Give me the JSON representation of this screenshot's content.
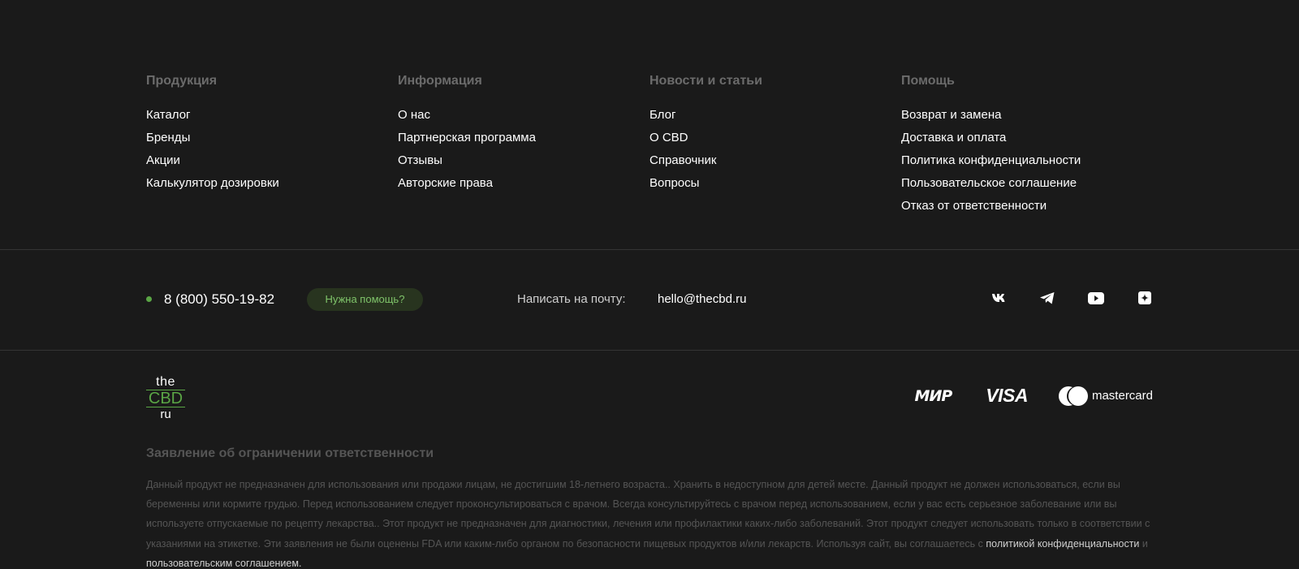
{
  "columns": [
    {
      "title": "Продукция",
      "items": [
        "Каталог",
        "Бренды",
        "Акции",
        "Калькулятор дозировки"
      ]
    },
    {
      "title": "Информация",
      "items": [
        "О нас",
        "Партнерская программа",
        "Отзывы",
        "Авторские права"
      ]
    },
    {
      "title": "Новости и статьи",
      "items": [
        "Блог",
        "О CBD",
        "Справочник",
        "Вопросы"
      ]
    },
    {
      "title": "Помощь",
      "items": [
        "Возврат и замена",
        "Доставка и оплата",
        "Политика конфиденциальности",
        "Пользовательское соглашение",
        "Отказ от ответственности"
      ]
    }
  ],
  "contact": {
    "phone": "8 (800) 550-19-82",
    "help_button": "Нужна помощь?",
    "mail_label": "Написать на почту:",
    "email": "hello@thecbd.ru"
  },
  "socials": [
    "vk-icon",
    "telegram-icon",
    "youtube-icon",
    "dzen-icon"
  ],
  "logo": {
    "line1": "the",
    "line2": "CBD",
    "line3": "ru"
  },
  "payments": {
    "mir": "МИР",
    "visa": "VISA",
    "mastercard": "mastercard"
  },
  "disclaimer": {
    "title": "Заявление об ограничении ответственности",
    "text": "Данный продукт не предназначен для использования или продажи лицам, не достигшим 18-летнего возраста.. Хранить в недоступном для детей месте. Данный продукт не должен использоваться, если вы беременны или кормите грудью. Перед использованием следует проконсультироваться с врачом. Всегда консультируйтесь с врачом перед использованием, если у вас есть серьезное заболевание или вы используете отпускаемые по рецепту лекарства.. Этот продукт не предназначен для диагностики, лечения или профилактики каких-либо заболеваний. Этот продукт следует использовать только в соответствии с указаниями на этикетке. Эти заявления не были оценены FDA или каким-либо органом по безопасности пищевых продуктов и/или лекарств. Используя сайт, вы соглашаетесь с",
    "privacy_link": "политикой конфиденциальности",
    "and": "и",
    "terms_link": "пользовательским соглашением."
  },
  "colors": {
    "background": "#1a1a1a",
    "accent": "#5aa545",
    "muted": "#6b6b6b"
  }
}
